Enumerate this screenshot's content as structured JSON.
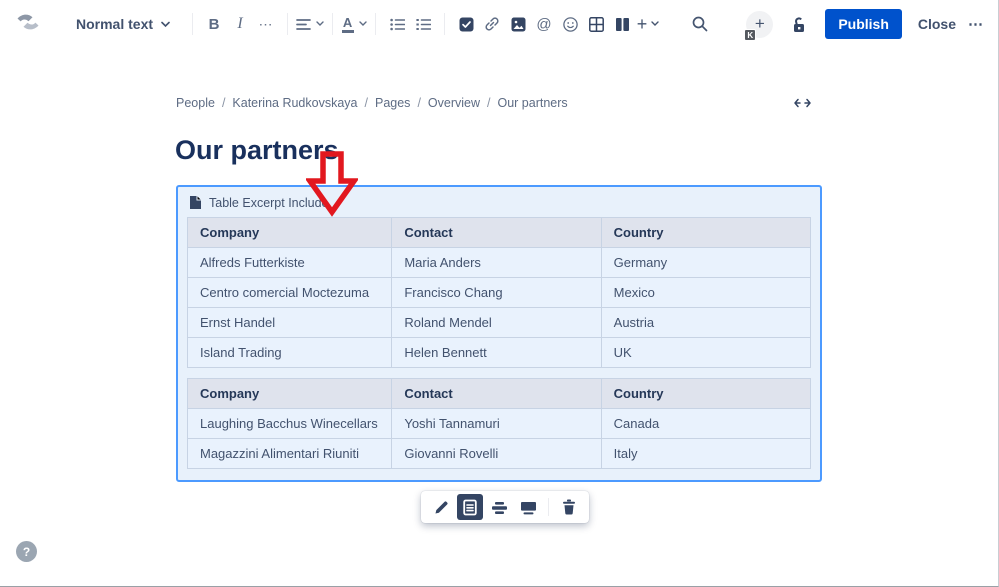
{
  "toolbar": {
    "style_dropdown_label": "Normal text",
    "bold_glyph": "B",
    "italic_glyph": "I",
    "more_formatting_glyph": "⋯",
    "text_color_glyph": "A",
    "mention_glyph": "@",
    "insert_glyph": "+",
    "publish_label": "Publish",
    "close_label": "Close",
    "overflow_glyph": "⋯",
    "avatar_badge": "K",
    "collaborator_add_glyph": "+"
  },
  "breadcrumb": {
    "items": [
      "People",
      "Katerina Rudkovskaya",
      "Pages",
      "Overview",
      "Our partners"
    ],
    "separator": "/"
  },
  "page": {
    "title": "Our partners"
  },
  "macro": {
    "title": "Table Excerpt Include",
    "tables": [
      {
        "headers": [
          "Company",
          "Contact",
          "Country"
        ],
        "rows": [
          [
            "Alfreds Futterkiste",
            "Maria Anders",
            "Germany"
          ],
          [
            "Centro comercial Moctezuma",
            "Francisco Chang",
            "Mexico"
          ],
          [
            "Ernst Handel",
            "Roland Mendel",
            "Austria"
          ],
          [
            "Island Trading",
            "Helen Bennett",
            "UK"
          ]
        ]
      },
      {
        "headers": [
          "Company",
          "Contact",
          "Country"
        ],
        "rows": [
          [
            "Laughing Bacchus Winecellars",
            "Yoshi Tannamuri",
            "Canada"
          ],
          [
            "Magazzini Alimentari Riuniti",
            "Giovanni Rovelli",
            "Italy"
          ]
        ]
      }
    ]
  },
  "help": {
    "glyph": "?"
  },
  "colors": {
    "publish_button": "#0052cc",
    "macro_selected_border": "#4c9aff",
    "macro_background": "#e8f1fb",
    "table_header_background": "#dfe3ed",
    "table_row_background": "#e9f2fd",
    "annotation_arrow": "#e2181f",
    "title_text": "#19305d",
    "toolbar_icon": "#5e6c84"
  }
}
